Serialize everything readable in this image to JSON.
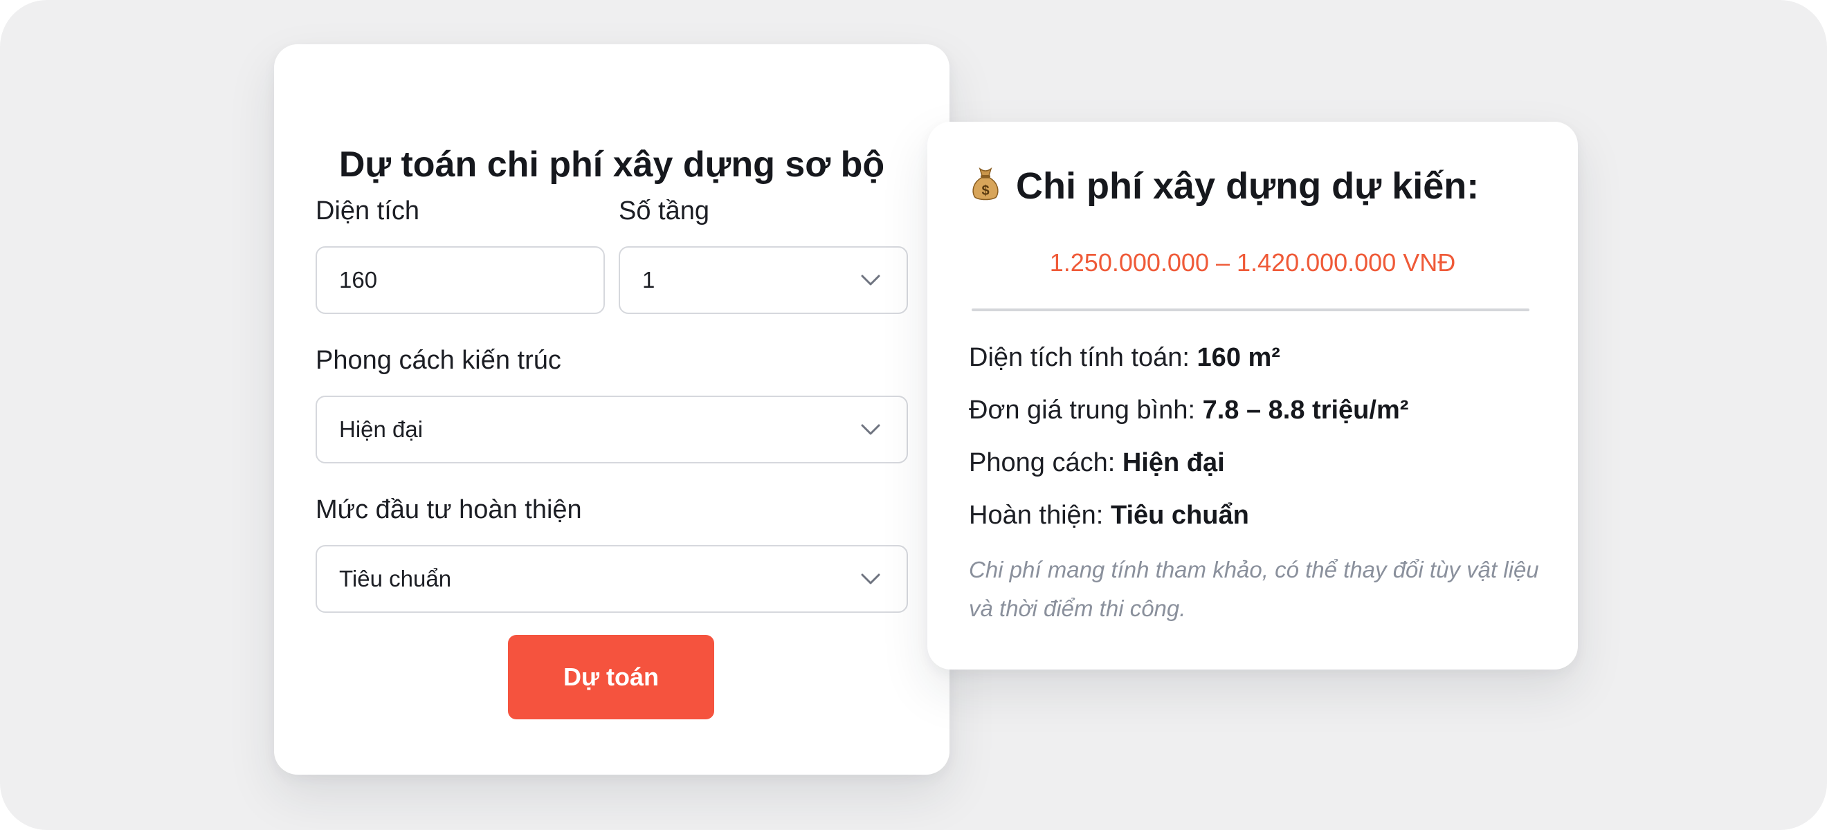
{
  "form": {
    "title": "Dự toán chi phí xây dựng sơ bộ",
    "area_label": "Diện tích",
    "area_value": "160",
    "floors_label": "Số tầng",
    "floors_value": "1",
    "style_label": "Phong cách kiến trúc",
    "style_value": "Hiện đại",
    "finish_label": "Mức đầu tư hoàn thiện",
    "finish_value": "Tiêu chuẩn",
    "submit_label": "Dự toán"
  },
  "result": {
    "icon": "money-bag-icon",
    "title": "Chi phí xây dựng dự kiến:",
    "range": "1.250.000.000 – 1.420.000.000 VNĐ",
    "area_label": "Diện tích tính toán:",
    "area_value": "160 m²",
    "unit_price_label": "Đơn giá trung bình:",
    "unit_price_value": "7.8 – 8.8 triệu/m²",
    "style_label": "Phong cách:",
    "style_value": "Hiện đại",
    "finish_label": "Hoàn thiện:",
    "finish_value": "Tiêu chuẩn",
    "note": "Chi phí mang tính tham khảo, có thể thay đổi tùy vật liệu và thời điểm thi công."
  },
  "colors": {
    "accent": "#f5533e",
    "range_text": "#ef5a38",
    "background": "#efeff0",
    "note_text": "#8a909c"
  }
}
